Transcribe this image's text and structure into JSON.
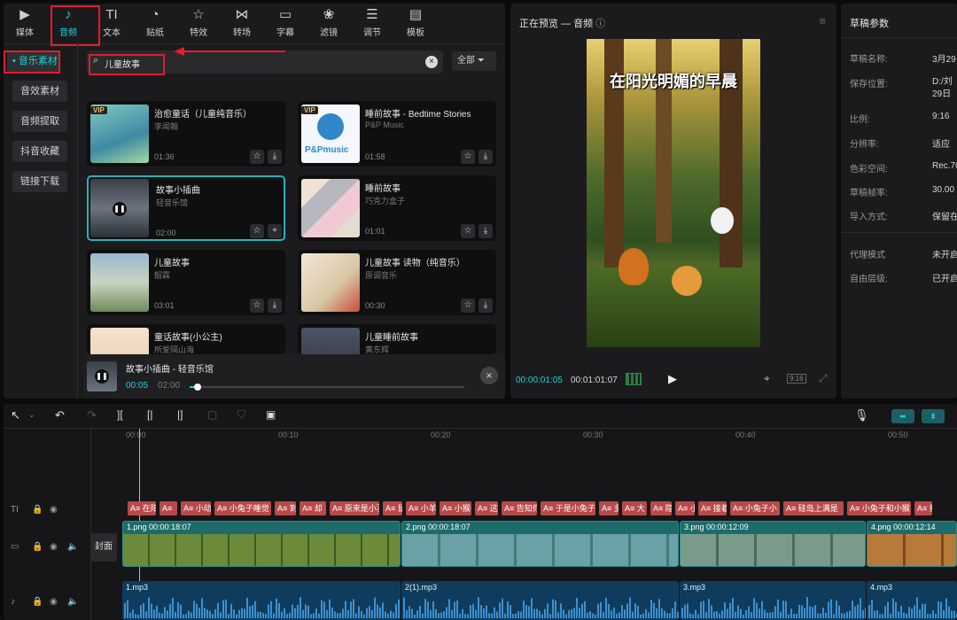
{
  "toolbar": {
    "items": [
      {
        "label": "媒体",
        "icon": "media-icon"
      },
      {
        "label": "音频",
        "icon": "audio-icon"
      },
      {
        "label": "文本",
        "icon": "text-icon"
      },
      {
        "label": "贴纸",
        "icon": "sticker-icon"
      },
      {
        "label": "特效",
        "icon": "effects-icon"
      },
      {
        "label": "转场",
        "icon": "transition-icon"
      },
      {
        "label": "字幕",
        "icon": "caption-icon"
      },
      {
        "label": "滤镜",
        "icon": "filter-icon"
      },
      {
        "label": "调节",
        "icon": "adjust-icon"
      },
      {
        "label": "模板",
        "icon": "template-icon"
      }
    ]
  },
  "sidebar": {
    "items": [
      "• 音乐素材",
      "音效素材",
      "音频提取",
      "抖音收藏",
      "链接下载"
    ]
  },
  "search": {
    "value": "儿童故事",
    "filter_label": "全部"
  },
  "music": [
    {
      "title": "治愈童话（儿童纯音乐）",
      "artist": "李闻翰",
      "duration": "01:36",
      "vip": "VIP"
    },
    {
      "title": "睡前故事 - Bedtime Stories",
      "artist": "P&P Music",
      "duration": "01:58",
      "vip": "VIP",
      "cover_text": "P&Pmusic"
    },
    {
      "title": "故事小插曲",
      "artist": "轻音乐馆",
      "duration": "02:00"
    },
    {
      "title": "睡前故事",
      "artist": "巧克力盒子",
      "duration": "01:01"
    },
    {
      "title": "儿童故事",
      "artist": "韶霖",
      "duration": "03:01"
    },
    {
      "title": "儿童故事 读物（纯音乐）",
      "artist": "原调音乐",
      "duration": "00:30"
    },
    {
      "title": "童话故事(小公主)",
      "artist": "所爱隔山海",
      "duration": ""
    },
    {
      "title": "儿童睡前故事",
      "artist": "黄东辉",
      "duration": ""
    }
  ],
  "player": {
    "title": "故事小插曲 - 轻音乐馆",
    "current": "00:05",
    "total": "02:00",
    "progress": 0.03
  },
  "preview": {
    "title": "正在预览 — 音频",
    "caption": "在阳光明媚的早晨",
    "timecode": "00:00:01:05",
    "duration": "00:01:01:07",
    "ratio": "9:16"
  },
  "props": {
    "title": "草稿参数",
    "rows": [
      {
        "label": "草稿名称:",
        "value": "3月29"
      },
      {
        "label": "保存位置:",
        "value": "D:/刘\n29日"
      },
      {
        "label": "比例:",
        "value": "9:16"
      },
      {
        "label": "分辨率:",
        "value": "适应"
      },
      {
        "label": "色彩空间:",
        "value": "Rec.70"
      },
      {
        "label": "草稿帧率:",
        "value": "30.00"
      },
      {
        "label": "导入方式:",
        "value": "保留在"
      },
      {
        "label": "代理模式",
        "value": "未开启"
      },
      {
        "label": "自由层级:",
        "value": "已开启"
      }
    ]
  },
  "timeline": {
    "ruler": [
      "00:00",
      "00:10",
      "00:20",
      "00:30",
      "00:40",
      "00:50"
    ],
    "cover_label": "封面",
    "text_clips": [
      "A≡ 在阳",
      "A≡",
      "A≡ 小动",
      "A≡ 小兔子睡觉",
      "A≡ 到",
      "A≡ 却",
      "A≡ 原来是小羽",
      "A≡ 鼠",
      "A≡ 小羊",
      "A≡ 小猴子",
      "A≡ 这",
      "A≡ 告知你",
      "A≡ 于是小兔子",
      "A≡ 多",
      "A≡ 大",
      "A≡ 隐",
      "A≡ 小猴",
      "A≡ 接着",
      "A≡ 小兔子小",
      "A≡ 硅岛上满是",
      "A≡ 小兔子和小猴",
      "A≡ 打"
    ],
    "video_clips": [
      {
        "name": "1.png",
        "dur": "00:00:18:07"
      },
      {
        "name": "2.png",
        "dur": "00:00:18:07"
      },
      {
        "name": "3.png",
        "dur": "00:00:12:09"
      },
      {
        "name": "4.png",
        "dur": "00:00:12:14"
      }
    ],
    "audio_clips": [
      "1.mp3",
      "2(1).mp3",
      "3.mp3",
      "4.mp3"
    ]
  }
}
